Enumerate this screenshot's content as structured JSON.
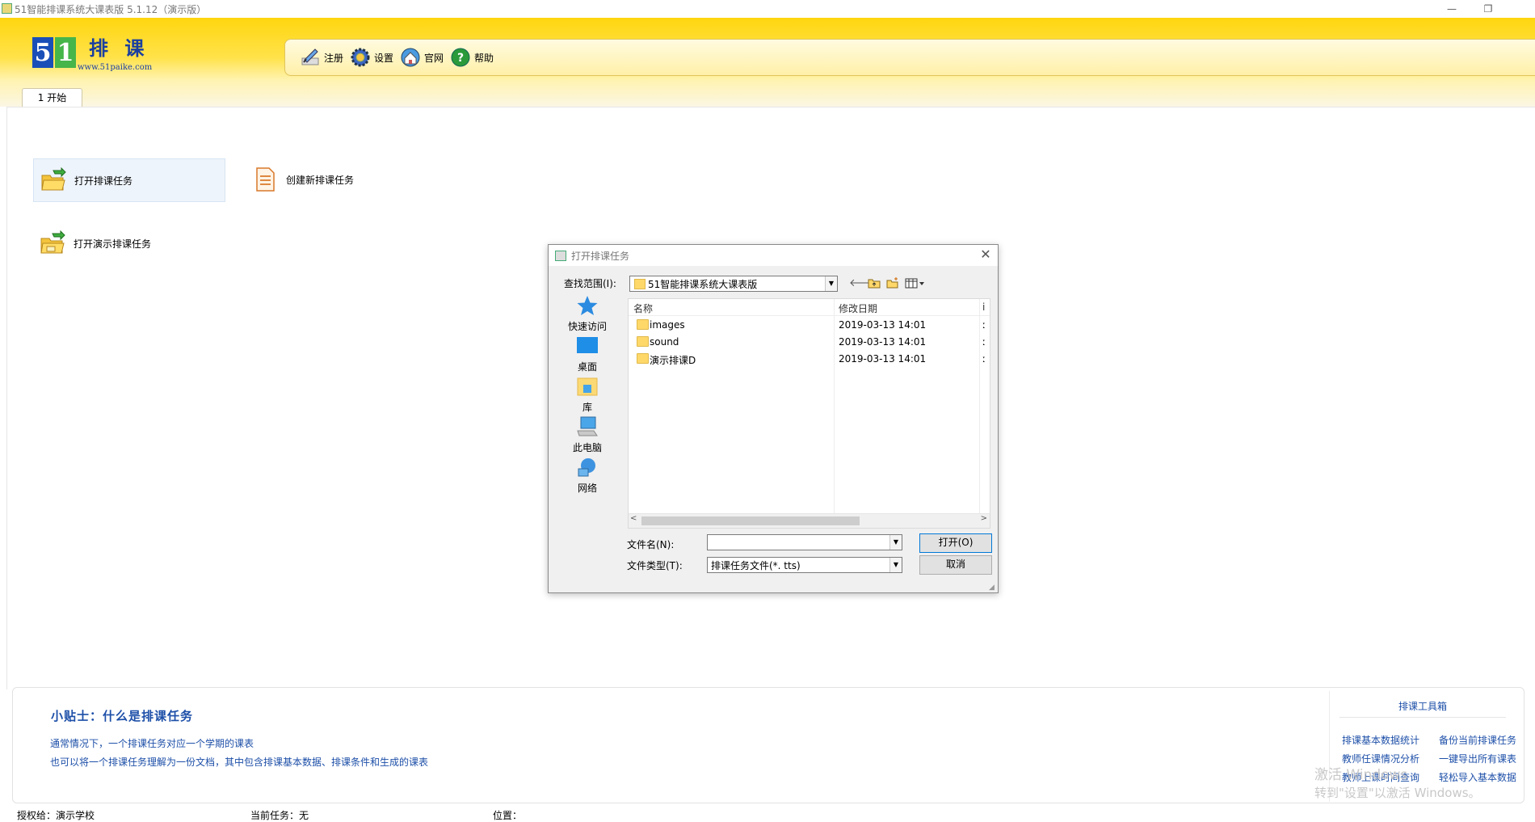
{
  "window": {
    "title": "51智能排课系统大课表版 5.1.12（演示版）",
    "minimize": "—",
    "restore": "❐"
  },
  "logo": {
    "digit1": "5",
    "digit2": "1",
    "name": "排 课",
    "url": "www.51paike.com"
  },
  "toolbar": [
    {
      "label": "注册",
      "icon": "register-icon"
    },
    {
      "label": "设置",
      "icon": "settings-gear-icon"
    },
    {
      "label": "官网",
      "icon": "website-home-icon"
    },
    {
      "label": "帮助",
      "icon": "help-icon"
    }
  ],
  "tab": {
    "label": "1 开始"
  },
  "actions": {
    "open_task": "打开排课任务",
    "create_task": "创建新排课任务",
    "open_demo": "打开演示排课任务"
  },
  "dialog": {
    "title": "打开排课任务",
    "look_in_label": "查找范围(I):",
    "look_in_value": "51智能排课系统大课表版",
    "places": [
      {
        "label": "快速访问",
        "icon": "quick-access-star-icon"
      },
      {
        "label": "桌面",
        "icon": "desktop-icon"
      },
      {
        "label": "库",
        "icon": "library-icon"
      },
      {
        "label": "此电脑",
        "icon": "this-pc-icon"
      },
      {
        "label": "网络",
        "icon": "network-icon"
      }
    ],
    "columns": {
      "name": "名称",
      "modified": "修改日期",
      "extra": "i"
    },
    "files": [
      {
        "name": "images",
        "date": "2019-03-13 14:01",
        "extra": "ː"
      },
      {
        "name": "sound",
        "date": "2019-03-13 14:01",
        "extra": "ː"
      },
      {
        "name": "演示排课D",
        "date": "2019-03-13 14:01",
        "extra": "ː"
      }
    ],
    "filename_label": "文件名(N):",
    "filename_value": "",
    "filetype_label": "文件类型(T):",
    "filetype_value": "排课任务文件(*. tts)",
    "open_button": "打开(O)",
    "cancel_button": "取消"
  },
  "tips": {
    "heading": "小贴士：什么是排课任务",
    "line1": "通常情况下，一个排课任务对应一个学期的课表",
    "line2": "也可以将一个排课任务理解为一份文档，其中包含排课基本数据、排课条件和生成的课表"
  },
  "toolbox": {
    "heading": "排课工具箱",
    "links": [
      "排课基本数据统计",
      "备份当前排课任务",
      "教师任课情况分析",
      "一键导出所有课表",
      "教师上课时间查询",
      "轻松导入基本数据"
    ]
  },
  "watermark": {
    "line1": "激活 Windows",
    "line2": "转到\"设置\"以激活 Windows。"
  },
  "status": {
    "licensee": "授权给：演示学校",
    "current_task": "当前任务：无",
    "location": "位置："
  },
  "colors": {
    "header_yellow": "#ffd60f",
    "link_blue": "#1d4fa8",
    "logo_blue": "#1a4fb8",
    "logo_green": "#46b54a"
  }
}
